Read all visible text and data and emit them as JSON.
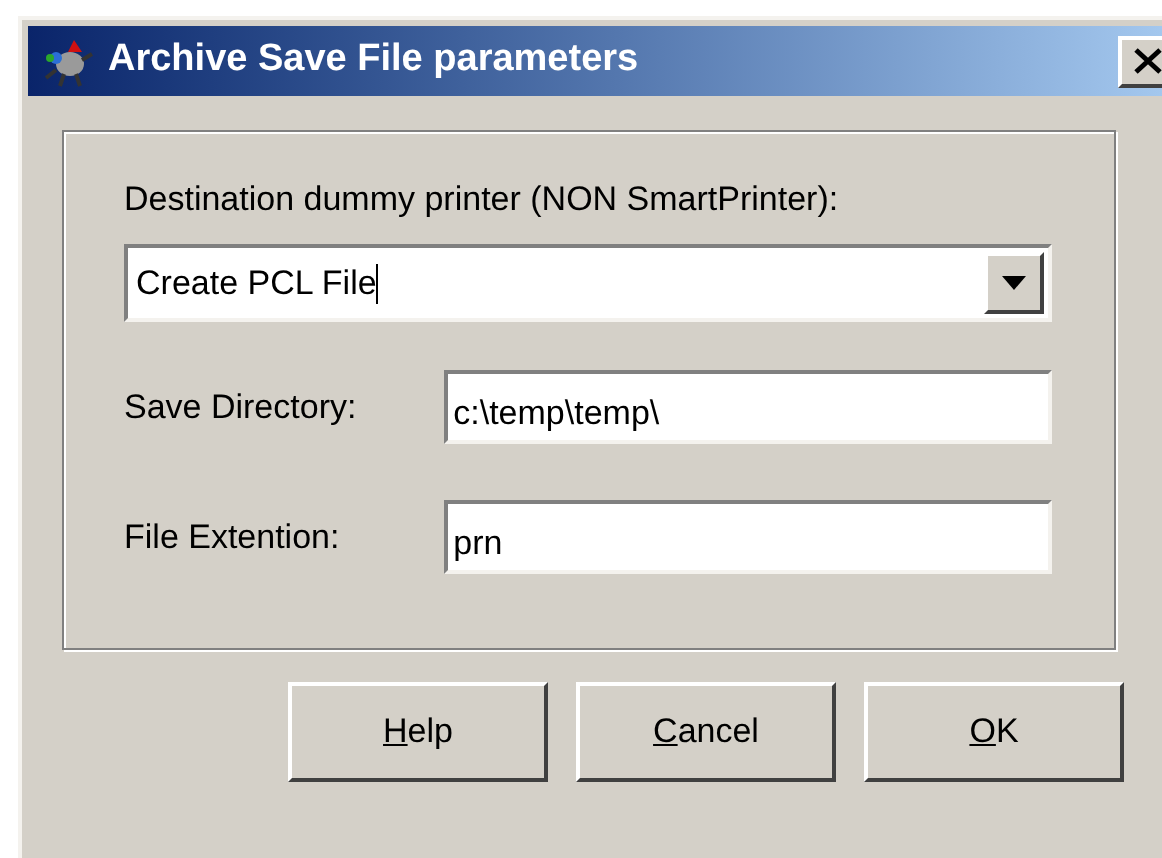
{
  "window": {
    "title": "Archive Save File parameters"
  },
  "destination": {
    "label": "Destination dummy printer (NON SmartPrinter):",
    "value": "Create PCL File",
    "focused": true
  },
  "fields": [
    {
      "label": "Save Directory:",
      "value": "c:\\temp\\temp\\"
    },
    {
      "label": "File Extention:",
      "value": "prn"
    }
  ],
  "buttons": [
    {
      "label": "Help"
    },
    {
      "label": "Cancel"
    },
    {
      "label": "OK"
    }
  ]
}
